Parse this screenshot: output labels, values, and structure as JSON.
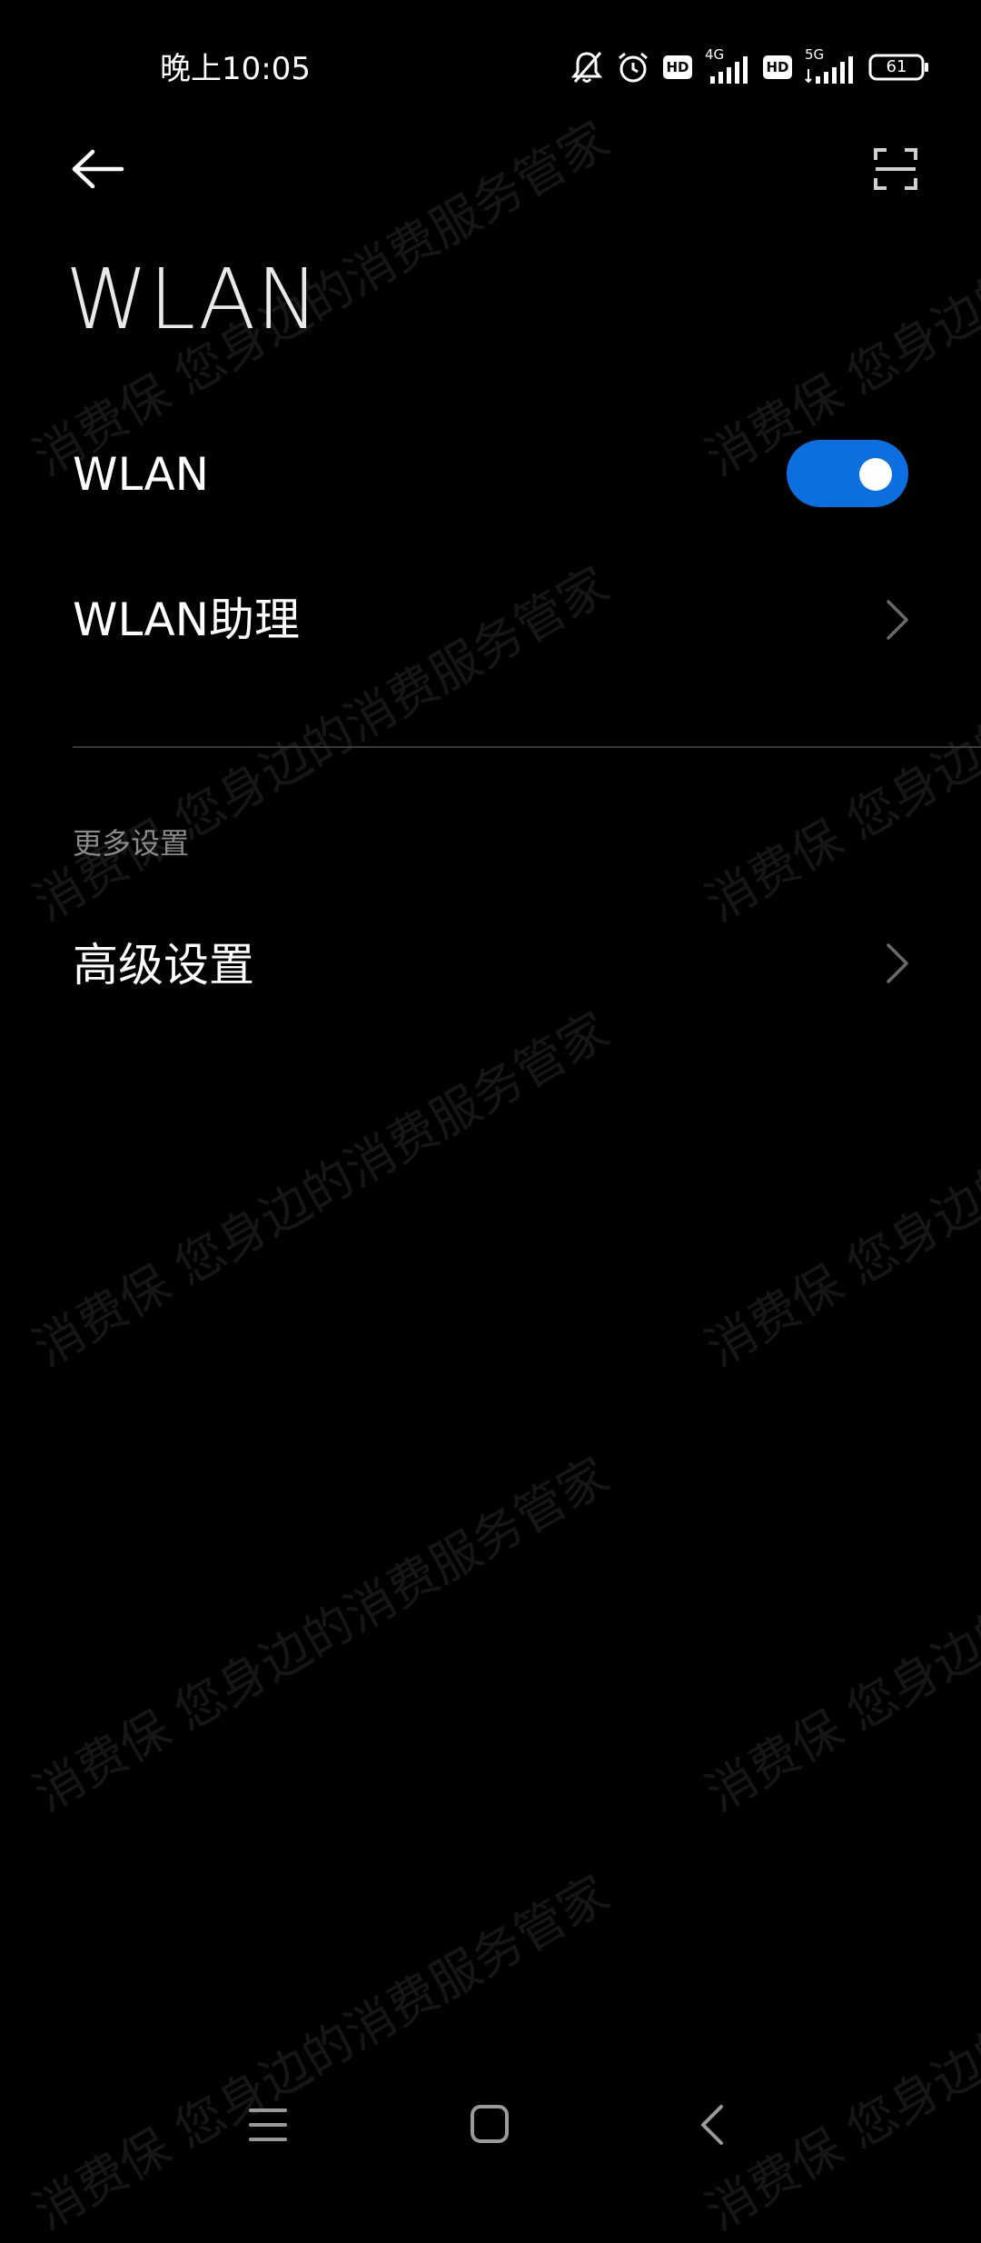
{
  "status_bar": {
    "time": "晚上10:05",
    "icons": [
      "mute-bell-icon",
      "alarm-icon",
      "hd-icon",
      "4g-signal-icon",
      "hd-icon",
      "5g-signal-icon",
      "battery-icon"
    ],
    "network_4g": "4G",
    "network_5g": "5G",
    "hd_label": "HD",
    "battery": "61"
  },
  "toolbar": {
    "back_icon": "arrow-left-icon",
    "scan_icon": "scan-icon"
  },
  "page": {
    "title": "WLAN"
  },
  "settings": {
    "wlan_label": "WLAN",
    "wlan_enabled": true,
    "assistant_label": "WLAN助理",
    "section_header": "更多设置",
    "advanced_label": "高级设置"
  },
  "watermark": {
    "line_1": "消费保 您身边的消费服务管家",
    "line_2": "消费保 您身边的消费服务管家"
  },
  "colors": {
    "background": "#000000",
    "accent": "#0b6fe0",
    "text": "#ffffff",
    "secondary_text": "#8a8a8a",
    "divider": "#3a3a3a"
  },
  "nav_bar": {
    "icons": [
      "menu-icon",
      "home-icon",
      "back-icon"
    ]
  }
}
